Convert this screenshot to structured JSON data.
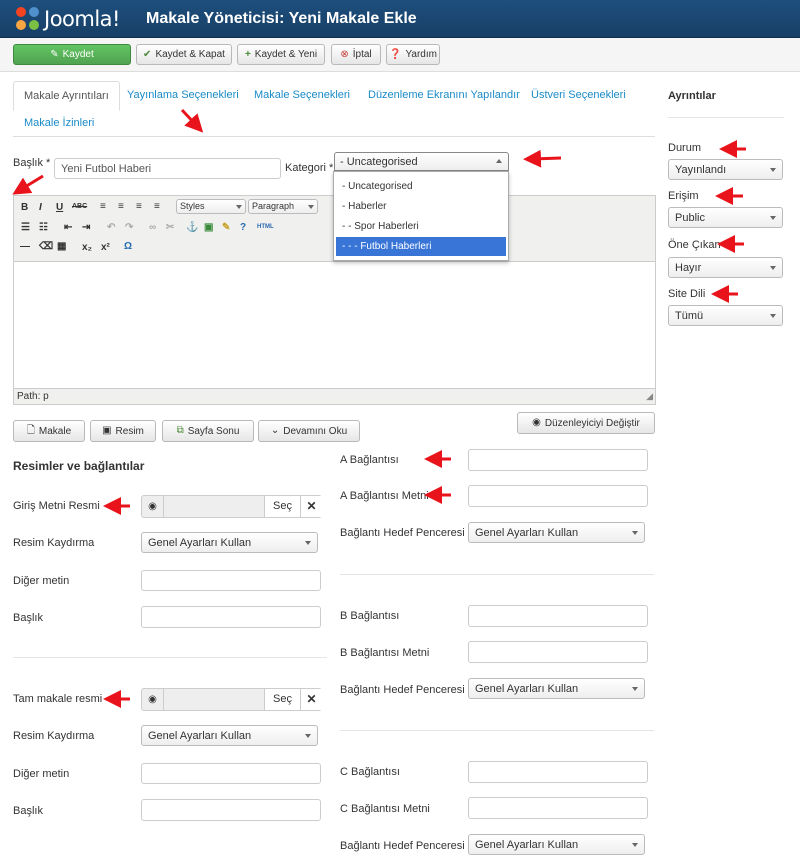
{
  "header": {
    "logo_text": "Joomla!",
    "title": "Makale Yöneticisi: Yeni Makale Ekle"
  },
  "toolbar": {
    "save": "Kaydet",
    "save_close": "Kaydet & Kapat",
    "save_new": "Kaydet & Yeni",
    "cancel": "İptal",
    "help": "Yardım"
  },
  "tabs": [
    "Makale Ayrıntıları",
    "Yayınlama Seçenekleri",
    "Makale Seçenekleri",
    "Düzenleme Ekranını Yapılandır",
    "Üstveri Seçenekleri",
    "Makale İzinleri"
  ],
  "form": {
    "title_label": "Başlık *",
    "title_value": "Yeni Futbol Haberi",
    "category_label": "Kategori *",
    "category_value": "- Uncategorised"
  },
  "category_options": [
    "- Uncategorised",
    "- Haberler",
    "- - Spor Haberleri",
    "- - - Futbol Haberleri"
  ],
  "editor": {
    "styles": "Styles",
    "format": "Paragraph",
    "path": "Path: p"
  },
  "editor_buttons": {
    "article": "Makale",
    "image": "Resim",
    "pagebreak": "Sayfa Sonu",
    "readmore": "Devamını Oku",
    "toggle": "Düzenleyiciyi Değiştir"
  },
  "images": {
    "heading": "Resimler ve bağlantılar",
    "intro_image": "Giriş Metni Resmi",
    "float": "Resim Kaydırma",
    "float_value": "Genel Ayarları Kullan",
    "alt": "Diğer metin",
    "caption": "Başlık",
    "full_image": "Tam makale resmi",
    "select": "Seç",
    "clear": "✕"
  },
  "links": {
    "a": "A Bağlantısı",
    "a_text": "A Bağlantısı Metni",
    "b": "B Bağlantısı",
    "b_text": "B Bağlantısı Metni",
    "c": "C Bağlantısı",
    "c_text": "C Bağlantısı Metni",
    "target": "Bağlantı Hedef Penceresi",
    "target_value": "Genel Ayarları Kullan"
  },
  "sidebar": {
    "heading": "Ayrıntılar",
    "status": "Durum",
    "status_value": "Yayınlandı",
    "access": "Erişim",
    "access_value": "Public",
    "featured": "Öne Çıkan",
    "featured_value": "Hayır",
    "language": "Site Dili",
    "language_value": "Tümü"
  },
  "colors": {
    "header_bg": "#1e4f7d",
    "save_green": "#51a351",
    "link_blue": "#1a8bc8",
    "arrow_red": "#e8131b",
    "selected_option": "#3875d7"
  }
}
